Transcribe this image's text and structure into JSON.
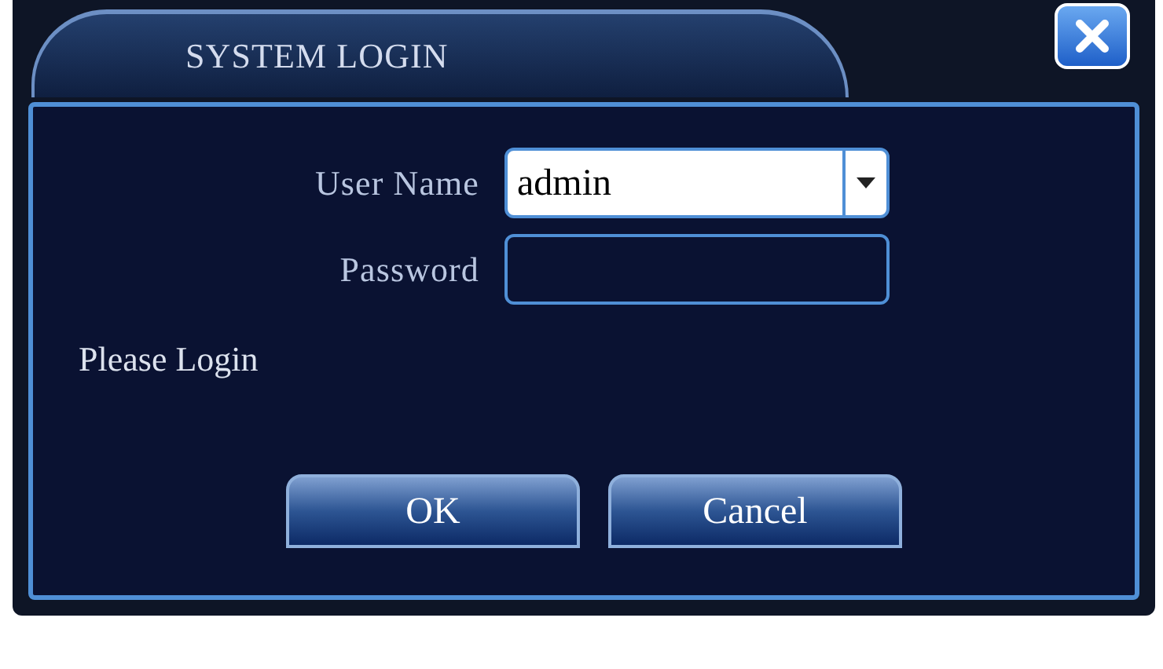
{
  "window": {
    "title": "SYSTEM LOGIN"
  },
  "fields": [
    {
      "kind": "dropdown",
      "label": "User Name",
      "value": "admin"
    },
    {
      "kind": "password",
      "label": "Password"
    }
  ],
  "message": "Please Login",
  "buttons": [
    "OK",
    "Cancel"
  ]
}
